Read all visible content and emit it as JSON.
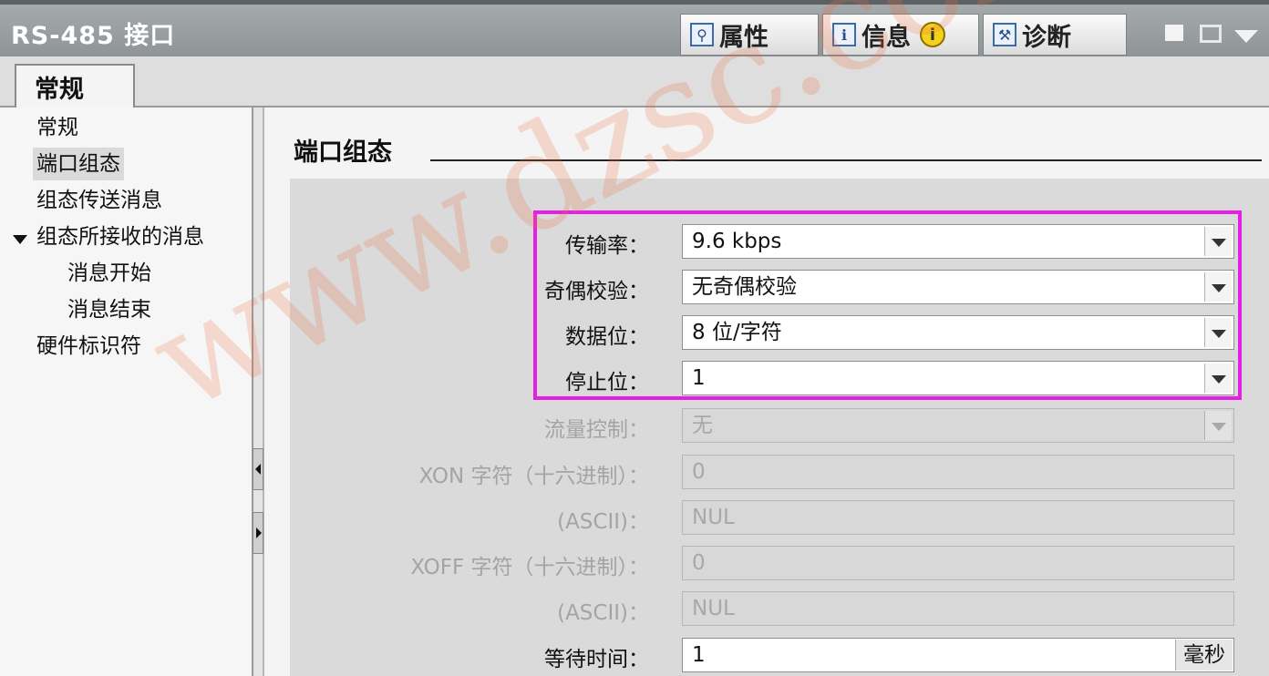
{
  "window": {
    "title": "RS-485 接口"
  },
  "top_tabs": [
    {
      "label": "属性",
      "icon": "properties-icon"
    },
    {
      "label": "信息",
      "icon": "info-list-icon",
      "badge": "i"
    },
    {
      "label": "诊断",
      "icon": "diagnostics-icon"
    }
  ],
  "sub_tab": {
    "label": "常规"
  },
  "nav": {
    "items": [
      "常规",
      "端口组态",
      "组态传送消息",
      "组态所接收的消息",
      "消息开始",
      "消息结束",
      "硬件标识符"
    ],
    "selected": "端口组态"
  },
  "section": {
    "title": "端口组态"
  },
  "fields": {
    "baud": {
      "label": "传输率：",
      "value": "9.6 kbps"
    },
    "parity": {
      "label": "奇偶校验：",
      "value": "无奇偶校验"
    },
    "databits": {
      "label": "数据位：",
      "value": "8 位/字符"
    },
    "stopbits": {
      "label": "停止位：",
      "value": "1"
    },
    "flow": {
      "label": "流量控制：",
      "value": "无"
    },
    "xon_hex": {
      "label": "XON 字符（十六进制）：",
      "value": "0"
    },
    "xon_ascii": {
      "label": "(ASCII)：",
      "value": "NUL"
    },
    "xoff_hex": {
      "label": "XOFF 字符（十六进制）：",
      "value": "0"
    },
    "xoff_ascii": {
      "label": "(ASCII)：",
      "value": "NUL"
    },
    "wait": {
      "label": "等待时间：",
      "value": "1",
      "unit": "毫秒"
    }
  },
  "watermark": "www.dzsc.com",
  "colors": {
    "highlight": "#e61ee6",
    "titlebar": "#9ba0a3",
    "watermark": "#ee6e3c"
  }
}
